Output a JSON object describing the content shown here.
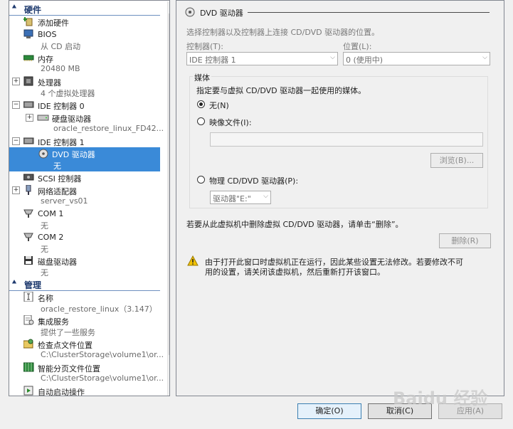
{
  "tree": {
    "hardware_header": "硬件",
    "management_header": "管理",
    "items": {
      "add_hardware": "添加硬件",
      "bios": "BIOS",
      "bios_sub": "从 CD 启动",
      "memory": "内存",
      "memory_sub": "20480 MB",
      "processor": "处理器",
      "processor_sub": "4 个虚拟处理器",
      "ide0": "IDE 控制器 0",
      "hdd": "硬盘驱动器",
      "hdd_sub": "oracle_restore_linux_FD42...",
      "ide1": "IDE 控制器 1",
      "dvd": "DVD 驱动器",
      "dvd_sub": "无",
      "scsi": "SCSI 控制器",
      "network": "网络适配器",
      "network_sub": "server_vs01",
      "com1": "COM 1",
      "com1_sub": "无",
      "com2": "COM 2",
      "com2_sub": "无",
      "floppy": "磁盘驱动器",
      "floppy_sub": "无",
      "name": "名称",
      "name_sub": "oracle_restore_linux（3.147）",
      "integration": "集成服务",
      "integration_sub": "提供了一些服务",
      "checkpoint": "检查点文件位置",
      "checkpoint_sub": "C:\\ClusterStorage\\volume1\\or...",
      "paging": "智能分页文件位置",
      "paging_sub": "C:\\ClusterStorage\\volume1\\or...",
      "autostart": "自动启动操作"
    }
  },
  "panel": {
    "title": "DVD 驱动器",
    "desc": "选择控制器以及控制器上连接 CD/DVD 驱动器的位置。",
    "controller_label": "控制器(T):",
    "controller_value": "IDE 控制器 1",
    "location_label": "位置(L):",
    "location_value": "0 (使用中)",
    "media_header": "媒体",
    "media_desc": "指定要与虚拟 CD/DVD 驱动器一起使用的媒体。",
    "none_label": "无(N)",
    "image_label": "映像文件(I):",
    "image_value": "",
    "browse_label": "浏览(B)...",
    "physical_label": "物理 CD/DVD 驱动器(P):",
    "physical_value": "驱动器\"E:\"",
    "remove_text": "若要从此虚拟机中删除虚拟 CD/DVD 驱动器，请单击“删除”。",
    "remove_label": "删除(R)",
    "warning_line1": "由于打开此窗口时虚拟机正在运行，因此某些设置无法修改。若要修改不可",
    "warning_line2": "用的设置，请关闭该虚拟机，然后重新打开该窗口。"
  },
  "footer": {
    "ok_label": "确定(O)",
    "cancel_label": "取消(C)",
    "apply_label": "应用(A)"
  },
  "watermark": "Baidu 经验",
  "colors": {
    "selection": "#3a8ad8",
    "section_text": "#1e3a6e",
    "warning": "#f2c200"
  }
}
